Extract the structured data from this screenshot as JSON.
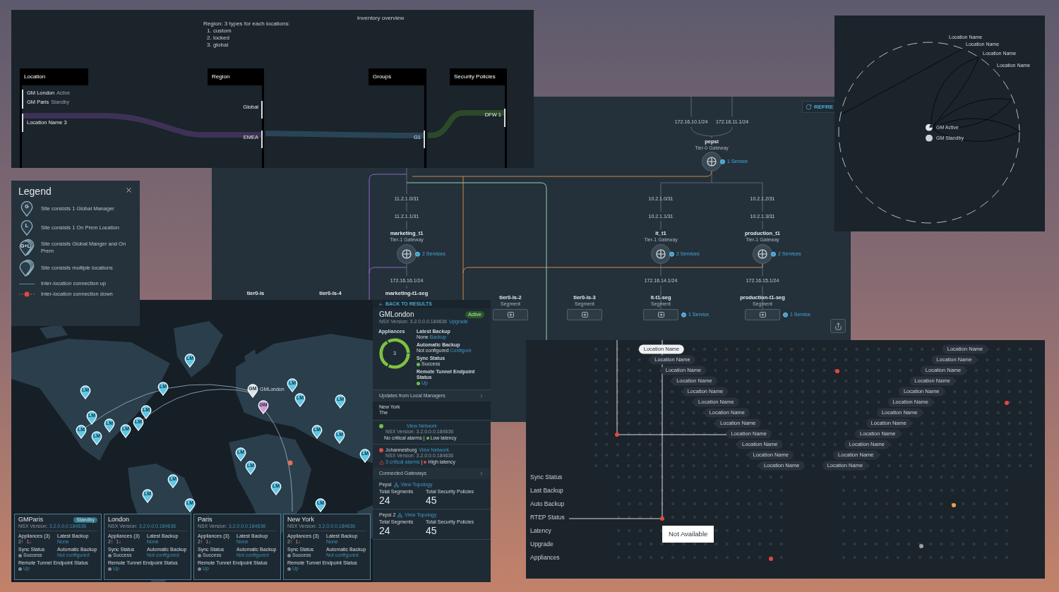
{
  "inventory": {
    "title": "inventory overview",
    "note": "Region: 3 types for each locations:",
    "note_items": [
      "1. custom",
      "2. locked",
      "3. global"
    ],
    "columns": [
      "Location",
      "Region",
      "Groups",
      "Security Policies"
    ],
    "locations": [
      {
        "name": "GM London",
        "status": "Active"
      },
      {
        "name": "GM Paris",
        "status": "Standby"
      },
      {
        "name": "Location Name 3"
      }
    ],
    "regions": [
      "Global",
      "EMEA"
    ],
    "groups": [
      "G1"
    ],
    "policies": [
      "DFW 1"
    ]
  },
  "topology": {
    "refresh": "REFRE",
    "tier0": {
      "name": "pepsi",
      "type": "Tier-0 Gateway",
      "services": "1 Service",
      "uplinks": [
        "172.16.10.1/24",
        "172.16.11.1/24"
      ]
    },
    "tier1": [
      {
        "name": "marketing_t1",
        "type": "Tier-1 Gateway",
        "services": "2 Services",
        "uplink_ips": [
          "11.2.1.0/31",
          "11.2.1.1/31"
        ],
        "downlink_ip": "172.16.16.1/24"
      },
      {
        "name": "it_t1",
        "type": "Tier-1 Gateway",
        "services": "2 Services",
        "uplink_ips": [
          "10.2.1.0/31",
          "10.2.1.1/31"
        ],
        "downlink_ip": "172.16.14.1/24"
      },
      {
        "name": "production_t1",
        "type": "Tier-1 Gateway",
        "services": "2 Services",
        "uplink_ips": [
          "10.2.1.2/31",
          "10.2.1.3/31"
        ],
        "downlink_ip": "172.16.15.1/24"
      }
    ],
    "segments": [
      {
        "name": "tier0-ls"
      },
      {
        "name": "tier0-ls-4"
      },
      {
        "name": "marketing-t1-seg"
      },
      {
        "name": "tier0-ls-2",
        "type": "Segment"
      },
      {
        "name": "tier0-ls-3",
        "type": "Segment"
      },
      {
        "name": "it-t1-seg",
        "type": "Segment",
        "services": "1 Service"
      },
      {
        "name": "production-t1-seg",
        "type": "Segment",
        "services": "1 Service"
      }
    ]
  },
  "circle": {
    "locations": [
      "Location Name",
      "Location Name",
      "Location Name",
      "Location Name"
    ],
    "nodes": [
      {
        "label": "GM Active",
        "kind": "active"
      },
      {
        "label": "GM Standby",
        "kind": "standby"
      }
    ]
  },
  "legend": {
    "title": "Legend",
    "items": [
      {
        "kind": "pin",
        "glyph": "G",
        "label": "Site consists 1 Global Manager"
      },
      {
        "kind": "pin",
        "glyph": "L",
        "label": "Site consists 1 On Prem Location"
      },
      {
        "kind": "stack",
        "glyph": "G+L",
        "label": "Site consists Global Manger and On Prem"
      },
      {
        "kind": "stack",
        "label": "Site consists multiple locations"
      },
      {
        "kind": "line_up",
        "label": "Inter-location connection up"
      },
      {
        "kind": "line_down",
        "label": "Inter-location connection down"
      }
    ]
  },
  "map": {
    "pins": [
      {
        "label": "LM",
        "kind": "local"
      },
      {
        "label": "LM",
        "kind": "local"
      },
      {
        "label": "LM",
        "kind": "local"
      },
      {
        "label": "LM",
        "kind": "local"
      },
      {
        "label": "LM",
        "kind": "local"
      },
      {
        "label": "LM",
        "kind": "local"
      },
      {
        "label": "LM",
        "kind": "local"
      },
      {
        "label": "LM",
        "kind": "local"
      },
      {
        "label": "LM",
        "kind": "local"
      },
      {
        "label": "LM",
        "kind": "local"
      },
      {
        "label": "LM",
        "kind": "local"
      },
      {
        "label": "LM",
        "kind": "local"
      },
      {
        "label": "LM",
        "kind": "local"
      },
      {
        "label": "LM",
        "kind": "local"
      },
      {
        "label": "LM",
        "kind": "local"
      },
      {
        "label": "LM",
        "kind": "local"
      },
      {
        "label": "LM",
        "kind": "local"
      },
      {
        "label": "LM",
        "kind": "local"
      },
      {
        "label": "LM",
        "kind": "local"
      },
      {
        "label": "LM",
        "kind": "local"
      },
      {
        "label": "LM",
        "kind": "local"
      },
      {
        "label": "LM",
        "kind": "local"
      },
      {
        "label": "LM",
        "kind": "local"
      },
      {
        "label": "GM",
        "kind": "global",
        "caption": "GMLondon"
      },
      {
        "label": "GM",
        "kind": "global_selected"
      }
    ],
    "cards": [
      {
        "name": "GMParis",
        "badge": "Standby",
        "version_label": "NSX Version:",
        "version": "3.2.0.0.0.184636",
        "appliances_label": "Appliances (3)",
        "up": "2↑",
        "down": "1↓",
        "backup_label": "Latest Backup",
        "backup": "None",
        "sync_label": "Sync Status",
        "sync": "Success",
        "auto_label": "Automatic Backup",
        "auto": "Not configured",
        "rtep_label": "Remote Tunnel Endpoint Status",
        "rtep": "Up"
      },
      {
        "name": "London",
        "version_label": "NSX Version:",
        "version": "3.2.0.0.0.184636",
        "appliances_label": "Appliances (3)",
        "up": "2↑",
        "down": "1↓",
        "backup_label": "Latest Backup",
        "backup": "None",
        "sync_label": "Sync Status",
        "sync": "Success",
        "auto_label": "Automatic Backup",
        "auto": "Not configured",
        "rtep_label": "Remote Tunnel Endpoint Status",
        "rtep": "Up"
      },
      {
        "name": "Paris",
        "version_label": "NSX Version:",
        "version": "3.2.0.0.0.184636",
        "appliances_label": "Appliances (3)",
        "up": "2↑",
        "down": "1↓",
        "backup_label": "Latest Backup",
        "backup": "None",
        "sync_label": "Sync Status",
        "sync": "Success",
        "auto_label": "Automatic Backup",
        "auto": "Not configured",
        "rtep_label": "Remote Tunnel Endpoint Status",
        "rtep": "Up"
      },
      {
        "name": "New York",
        "version_label": "NSX Version:",
        "version": "3.2.0.0.0.184636",
        "appliances_label": "Appliances (3)",
        "up": "2↑",
        "down": "1↓",
        "backup_label": "Latest Backup",
        "backup": "None",
        "sync_label": "Sync Status",
        "sync": "Success",
        "auto_label": "Automatic Backup",
        "auto": "Not configured",
        "rtep_label": "Remote Tunnel Endpoint Status",
        "rtep": "Up"
      }
    ]
  },
  "detail": {
    "back": "BACK TO RESULTS",
    "name": "GMLondon",
    "version": "NSX Version: 3.2.0.0.0.184636",
    "upgrade": "Upgrade",
    "badge": "Active",
    "appliances_label": "Appliances",
    "appliances": "3",
    "fields": [
      {
        "label": "Latest Backup",
        "value": "None",
        "action": "Backup",
        "link": false
      },
      {
        "label": "Automatic Backup",
        "value": "Not configured",
        "action": "Configure",
        "link": false
      },
      {
        "label": "Sync Status",
        "value": "Success",
        "healthy": true,
        "link": false
      },
      {
        "label": "Remote Tunnel Endpoint Status",
        "value": "Up",
        "healthy": true,
        "link": true
      }
    ],
    "updates_title": "Updates from Local Managers",
    "note_title": "New York",
    "note_body": "The",
    "managers": [
      {
        "healthy": true,
        "link": "View Network",
        "version": "NSX Version: 3.2.0.0.0.184636",
        "alarms": "No critical alarms",
        "critical": false,
        "separator": "|",
        "latency": "Low latency",
        "high_latency": false
      },
      {
        "healthy": false,
        "name": "Johannesburg",
        "link": "View Network",
        "version": "NSX Version: 3.2.0.0.0.184636",
        "alarms": "3 critical alarms",
        "critical": true,
        "separator": "|",
        "latency": "High latency",
        "high_latency": true
      }
    ],
    "gateways_title": "Connected Gateways",
    "gateways": [
      {
        "name": "Pepsi",
        "link": "View Topology",
        "segments_label": "Total Segments",
        "segments": "24",
        "policies_label": "Total Security Policies",
        "policies": "45"
      },
      {
        "name": "Pepsi 2",
        "link": "View Topology",
        "segments_label": "Total Segments",
        "segments": "24",
        "policies_label": "Total Security Policies",
        "policies": "45"
      }
    ]
  },
  "matrix": {
    "tags": [
      {
        "label": "Location Name",
        "selected": true
      },
      {
        "label": "Location Name",
        "selected": false
      },
      {
        "label": "Location Name",
        "selected": false
      },
      {
        "label": "Location Name",
        "selected": false
      },
      {
        "label": "Location Name",
        "selected": false
      },
      {
        "label": "Location Name",
        "selected": false
      },
      {
        "label": "Location Name",
        "selected": false
      },
      {
        "label": "Location Name",
        "selected": false
      },
      {
        "label": "Location Name",
        "selected": false
      },
      {
        "label": "Location Name",
        "selected": false
      },
      {
        "label": "Location Name",
        "selected": false
      },
      {
        "label": "Location Name",
        "selected": false
      },
      {
        "label": "Location Name",
        "selected": false
      },
      {
        "label": "Location Name",
        "selected": false
      },
      {
        "label": "Location Name",
        "selected": false
      },
      {
        "label": "Location Name",
        "selected": false
      },
      {
        "label": "Location Name",
        "selected": false
      },
      {
        "label": "Location Name",
        "selected": false
      },
      {
        "label": "Location Name",
        "selected": false
      },
      {
        "label": "Location Name",
        "selected": false
      },
      {
        "label": "Location Name",
        "selected": false
      },
      {
        "label": "Location Name",
        "selected": false
      },
      {
        "label": "Location Name",
        "selected": false
      },
      {
        "label": "Location Name",
        "selected": false
      }
    ],
    "rows": [
      "Sync Status",
      "Last Backup",
      "Auto Backup",
      "RTEP Status",
      "Latency",
      "Upgrade",
      "Appliances"
    ],
    "tooltip": "Not Available",
    "alerts": [
      {
        "color": "#e5483d"
      },
      {
        "color": "#e5483d"
      },
      {
        "color": "#e5483d"
      },
      {
        "color": "#e5483d"
      },
      {
        "color": "#f0a048"
      },
      {
        "color": "#9aa0a4"
      },
      {
        "color": "#e5483d"
      }
    ]
  }
}
